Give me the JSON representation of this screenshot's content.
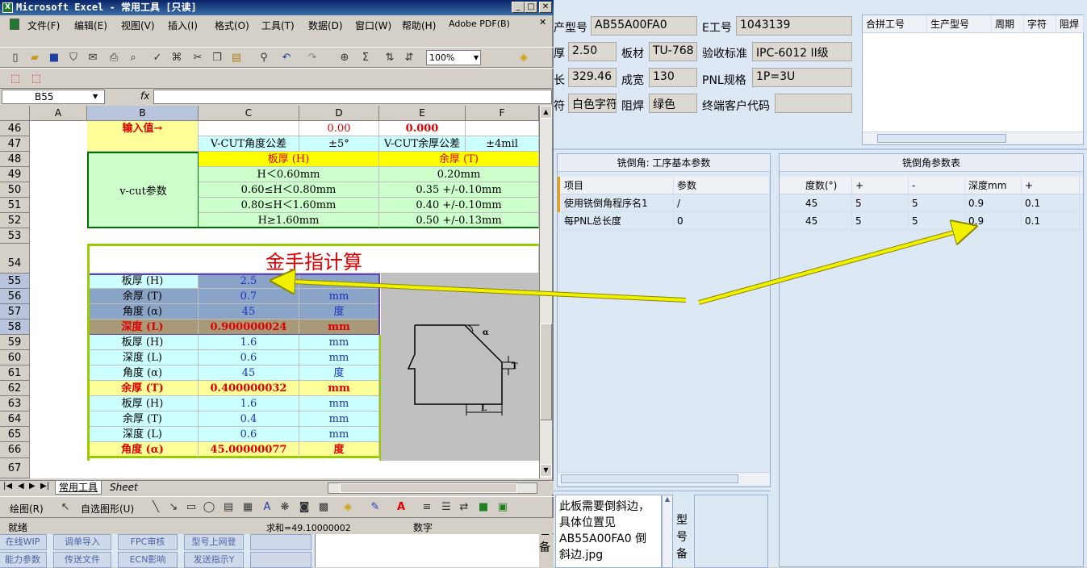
{
  "excel": {
    "title": "Microsoft Excel - 常用工具  [只读]",
    "menu": [
      "文件(F)",
      "编辑(E)",
      "视图(V)",
      "插入(I)",
      "格式(O)",
      "工具(T)",
      "数据(D)",
      "窗口(W)",
      "帮助(H)",
      "Adobe PDF(B)"
    ],
    "zoom": "100%",
    "name_box": "B55",
    "fx": "fx",
    "columns": [
      "A",
      "B",
      "C",
      "D",
      "E",
      "F"
    ],
    "rows": [
      "46",
      "47",
      "48",
      "49",
      "50",
      "51",
      "52",
      "53",
      "54",
      "55",
      "56",
      "57",
      "58",
      "59",
      "60",
      "61",
      "62",
      "63",
      "64",
      "65",
      "66",
      "67"
    ],
    "r46": {
      "b": "输入值→",
      "d": "0.00",
      "e": "0.000"
    },
    "r47": {
      "c": "V-CUT角度公差",
      "d": "±5°",
      "e": "V-CUT余厚公差",
      "f": "±4mil"
    },
    "vcut_label": "v-cut参数",
    "r48": {
      "c": "板厚 (H)",
      "e": "余厚 (T)"
    },
    "r49": {
      "c": "H＜0.60mm",
      "e": "0.20mm"
    },
    "r50": {
      "c": "0.60≤H＜0.80mm",
      "e": "0.35 +/-0.10mm"
    },
    "r51": {
      "c": "0.80≤H＜1.60mm",
      "e": "0.40 +/-0.10mm"
    },
    "r52": {
      "c": "H≥1.60mm",
      "e": "0.50 +/-0.13mm"
    },
    "r54": "金手指计算",
    "r55": {
      "b": "板厚 (H)",
      "c": "2.5"
    },
    "r56": {
      "b": "余厚 (T)",
      "c": "0.7",
      "d": "mm"
    },
    "r57": {
      "b": "角度 (α)",
      "c": "45",
      "d": "度"
    },
    "r58": {
      "b": "深度 (L)",
      "c": "0.900000024",
      "d": "mm"
    },
    "r59": {
      "b": "板厚 (H)",
      "c": "1.6",
      "d": "mm"
    },
    "r60": {
      "b": "深度 (L)",
      "c": "0.6",
      "d": "mm"
    },
    "r61": {
      "b": "角度 (α)",
      "c": "45",
      "d": "度"
    },
    "r62": {
      "b": "余厚 (T)",
      "c": "0.400000032",
      "d": "mm"
    },
    "r63": {
      "b": "板厚 (H)",
      "c": "1.6",
      "d": "mm"
    },
    "r64": {
      "b": "余厚 (T)",
      "c": "0.4",
      "d": "mm"
    },
    "r65": {
      "b": "深度 (L)",
      "c": "0.6",
      "d": "mm"
    },
    "r66": {
      "b": "角度 (α)",
      "c": "45.00000077",
      "d": "度"
    },
    "diagram": {
      "alpha": "α",
      "t": "T",
      "l": "L"
    },
    "tabs": [
      "常用工具",
      "Sheet"
    ],
    "draw_label": "绘图(R)",
    "autoshape_label": "自选图形(U)",
    "status": {
      "ready": "就绪",
      "sum": "求和=49.10000002",
      "num": "数字"
    },
    "taskbar": [
      "在线WIP",
      "调单导入",
      "FPC审核",
      "型号上网登",
      "",
      "能力参数",
      "传送文件",
      "ECN影响",
      "发送指示Y",
      ""
    ],
    "sum_icon": "Σ"
  },
  "app": {
    "fields": {
      "model_label": "产型号",
      "model": "AB55A00FA0",
      "eno_label": "E工号",
      "eno": "1043139",
      "thick_label": "厚",
      "thick": "2.50",
      "board_label": "板材",
      "board": "TU-768",
      "std_label": "验收标准",
      "std": "IPC-6012 II级",
      "len_label": "长",
      "len": "329.46",
      "width_label": "成宽",
      "width": "130",
      "pnl_label": "PNL规格",
      "pnl": "1P=3U",
      "char_label": "符",
      "char": "白色字符",
      "mask_label": "阻焊",
      "mask": "绿色",
      "cust_label": "终端客户代码",
      "cust": ""
    },
    "top_grid_headers": [
      "合拼工号",
      "生产型号",
      "周期",
      "字符",
      "阻焊"
    ],
    "left_panel": {
      "title": "铣倒角: 工序基本参数",
      "headers": [
        "项目",
        "参数"
      ],
      "rows": [
        [
          "使用铣倒角程序名1",
          "/"
        ],
        [
          "每PNL总长度",
          "0"
        ]
      ]
    },
    "right_panel": {
      "title": "铣倒角参数表",
      "headers": [
        "度数(°)",
        "+",
        "-",
        "深度mm",
        "+"
      ],
      "rows": [
        [
          "45",
          "5",
          "5",
          "0.9",
          "0.1"
        ],
        [
          "45",
          "5",
          "5",
          "0.9",
          "0.1"
        ]
      ]
    },
    "note": "此板需要倒斜边，具体位置见AB55A00FA0 倒斜边.jpg",
    "side_label": "型号备",
    "side_label2": "艺备",
    "accent_color": "#f0f000"
  }
}
